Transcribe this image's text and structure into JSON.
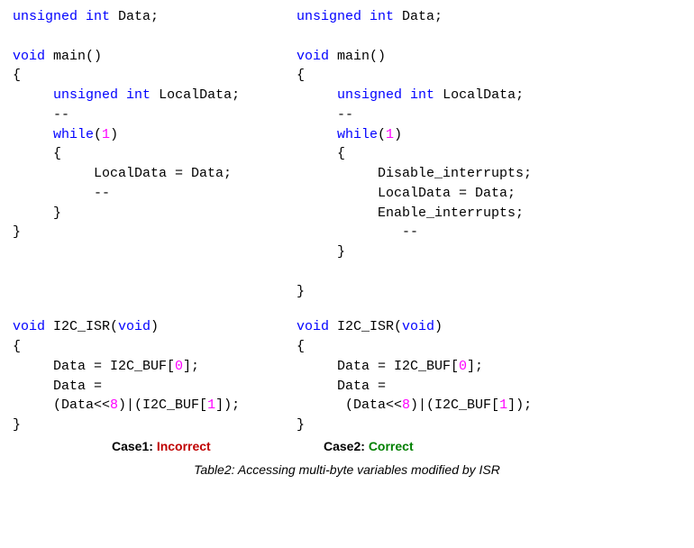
{
  "left": {
    "l1_kw1": "unsigned",
    "l1_kw2": "int",
    "l1_id": " Data;",
    "l3_kw": "void",
    "l3_rest": " main()",
    "l4": "{",
    "l5_pad": "     ",
    "l5_kw1": "unsigned",
    "l5_kw2": "int",
    "l5_id": " LocalData;",
    "l6": "     --",
    "l7_pad": "     ",
    "l7_kw": "while",
    "l7_open": "(",
    "l7_num": "1",
    "l7_close": ")",
    "l8": "     {",
    "l9": "          LocalData = Data;",
    "l10": "          --",
    "l11": "     }",
    "l12": "}",
    "i1_kw1": "void",
    "i1_name": " I2C_ISR(",
    "i1_kw2": "void",
    "i1_close": ")",
    "i2": "{",
    "i3_a": "     Data = I2C_BUF[",
    "i3_num": "0",
    "i3_b": "];",
    "i4": "     Data =",
    "i5_a": "     (Data<<",
    "i5_num1": "8",
    "i5_b": ")|(I2C_BUF[",
    "i5_num2": "1",
    "i5_c": "]);",
    "i6": "}"
  },
  "right": {
    "l1_kw1": "unsigned",
    "l1_kw2": "int",
    "l1_id": " Data;",
    "l3_kw": "void",
    "l3_rest": " main()",
    "l4": "{",
    "l5_pad": "     ",
    "l5_kw1": "unsigned",
    "l5_kw2": "int",
    "l5_id": " LocalData;",
    "l6": "     --",
    "l7_pad": "     ",
    "l7_kw": "while",
    "l7_open": "(",
    "l7_num": "1",
    "l7_close": ")",
    "l8": "     {",
    "l9": "          Disable_interrupts;",
    "l10": "          LocalData = Data;",
    "l11": "          Enable_interrupts;",
    "l12": "             --",
    "l13": "     }",
    "l15": "}",
    "i1_kw1": "void",
    "i1_name": " I2C_ISR(",
    "i1_kw2": "void",
    "i1_close": ")",
    "i2": "{",
    "i3_a": "     Data = I2C_BUF[",
    "i3_num": "0",
    "i3_b": "];",
    "i4": "     Data =",
    "i5_a": "      (Data<<",
    "i5_num1": "8",
    "i5_b": ")|(I2C_BUF[",
    "i5_num2": "1",
    "i5_c": "]);",
    "i6": "}"
  },
  "labels": {
    "case1_label": "Case1: ",
    "case1_status": "Incorrect",
    "case2_label": "Case2: ",
    "case2_status": "Correct"
  },
  "caption": "Table2: Accessing multi-byte variables modified by ISR"
}
